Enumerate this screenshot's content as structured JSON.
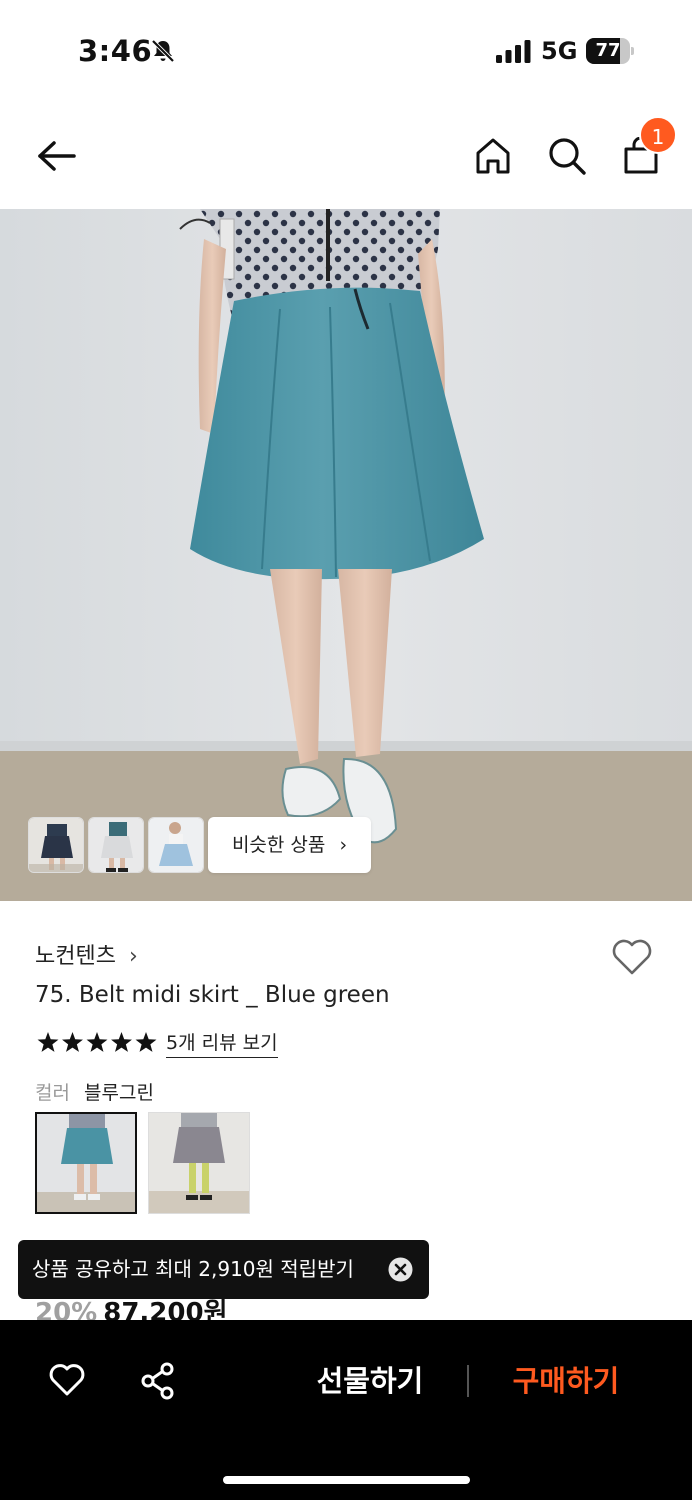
{
  "status_bar": {
    "time": "3:46",
    "network": "5G",
    "battery": "77",
    "battery_level": 0.77,
    "icons": [
      "bell-off-icon",
      "signal-icon"
    ]
  },
  "header": {
    "icons": [
      "back-arrow-icon",
      "home-icon",
      "search-icon",
      "shopping-bag-icon"
    ],
    "cart_count": "1",
    "badge_color": "#ff5a1f"
  },
  "gallery": {
    "similar_button_label": "비슷한 상품",
    "similar_button_chevron": "›"
  },
  "product": {
    "brand": "노컨텐츠",
    "brand_chevron": "›",
    "name": "75. Belt midi skirt _ Blue green",
    "rating_stars": 5,
    "review_link": "5개 리뷰 보기",
    "color_label": "컬러",
    "color_value": "블루그린",
    "discount": "20%",
    "price": "87,200원"
  },
  "toast": {
    "text": "상품 공유하고 최대 2,910원 적립받기"
  },
  "bottom_bar": {
    "gift_label": "선물하기",
    "buy_label": "구매하기",
    "buy_color": "#ff5a1f",
    "icons": [
      "heart-icon",
      "share-icon"
    ]
  }
}
